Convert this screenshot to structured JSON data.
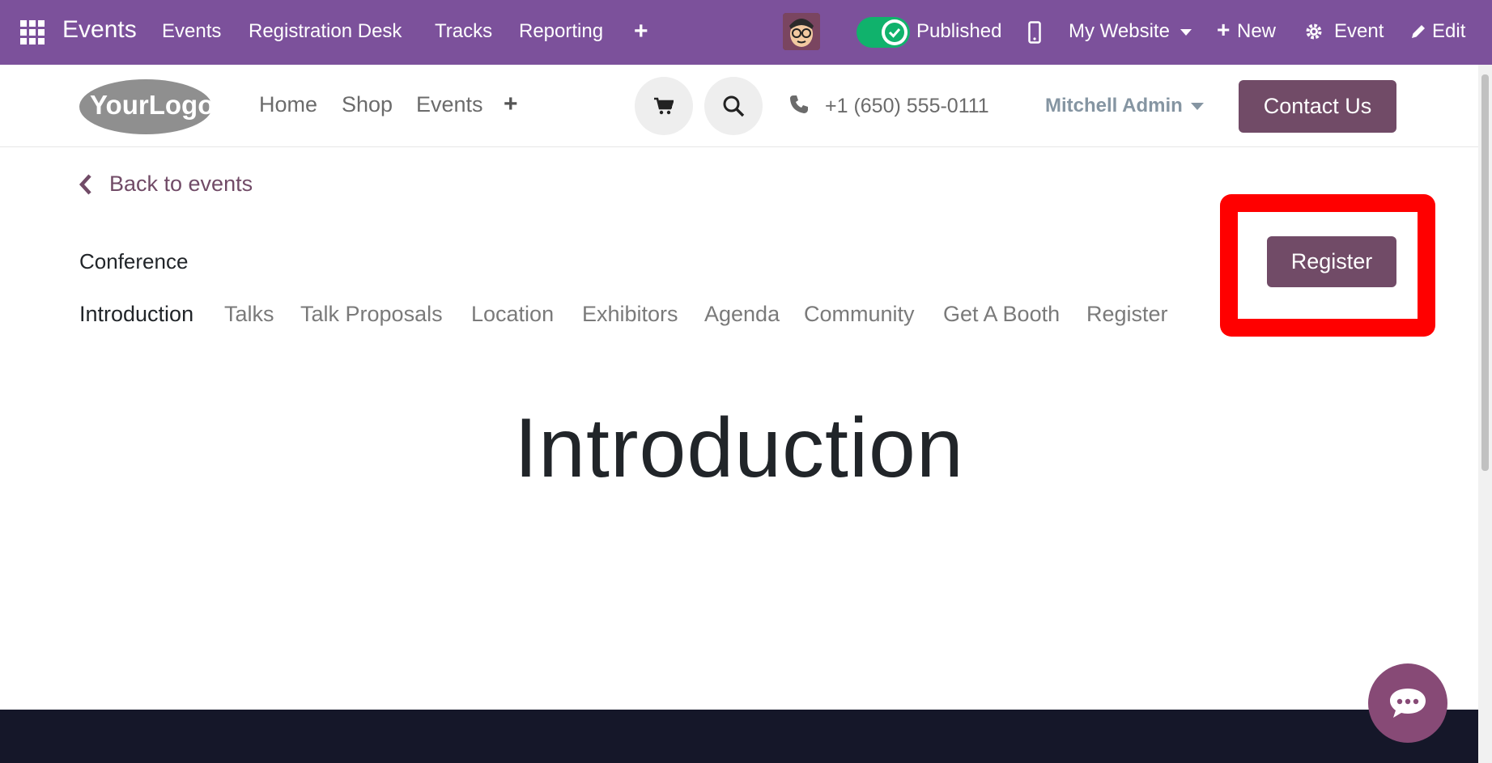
{
  "topbar": {
    "brand": "Events",
    "menu": [
      "Events",
      "Registration Desk",
      "Tracks",
      "Reporting"
    ],
    "published_label": "Published",
    "website_label": "My Website",
    "new_label": "New",
    "event_label": "Event",
    "edit_label": "Edit"
  },
  "header": {
    "logo_text": "YourLogo",
    "nav": [
      "Home",
      "Shop",
      "Events"
    ],
    "phone": "+1 (650) 555-0111",
    "user": "Mitchell Admin",
    "contact_label": "Contact Us"
  },
  "event": {
    "back_label": "Back to events",
    "name": "Conference",
    "tabs": [
      "Introduction",
      "Talks",
      "Talk Proposals",
      "Location",
      "Exhibitors",
      "Agenda",
      "Community",
      "Get A Booth",
      "Register"
    ],
    "active_tab": "Introduction",
    "register_label": "Register"
  },
  "content": {
    "heading": "Introduction"
  },
  "colors": {
    "topbar": "#7c519b",
    "primary": "#714b67",
    "highlight": "#ff0000",
    "footer": "#151729"
  }
}
